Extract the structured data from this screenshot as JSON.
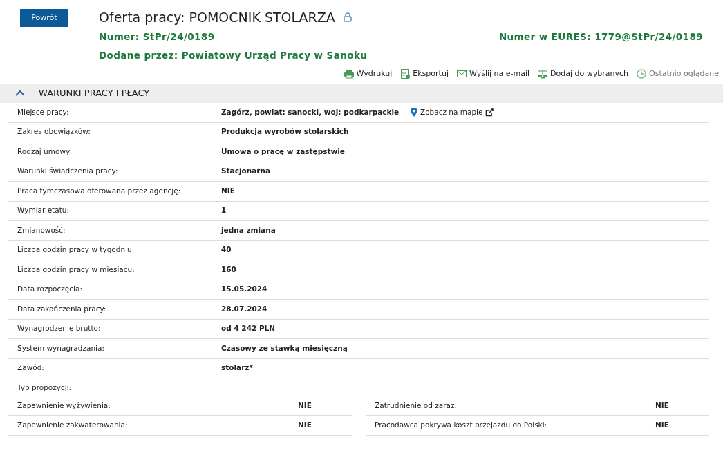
{
  "back_button": "Powrót",
  "title": "Oferta pracy: POMOCNIK STOLARZA",
  "number": "Numer: **StPr/24/0189**",
  "added_by": "Dodane przez: **Powiatowy Urząd Pracy w Sanoku**",
  "eures_number": "Numer w EURES: **1779@StPr/24/0189**",
  "toolbar": [
    {
      "kind": "print",
      "label": "Wydrukuj",
      "disabled": false
    },
    {
      "kind": "export",
      "label": "Eksportuj",
      "disabled": false
    },
    {
      "kind": "email",
      "label": "Wyślij na e-mail",
      "disabled": false
    },
    {
      "kind": "favorite",
      "label": "Dodaj do wybranych",
      "disabled": false
    },
    {
      "kind": "history",
      "label": "Ostatnio oglądane",
      "disabled": true
    }
  ],
  "section": {
    "title": "WARUNKI PRACY I PŁACY",
    "expanded": true
  },
  "rows": [
    {
      "label": "Miejsce pracy:",
      "value": "Zagórz, powiat: sanocki, woj: podkarpackie",
      "map_link": "Zobacz na mapie"
    },
    {
      "label": "Zakres obowiązków:",
      "value": "Produkcja wyrobów stolarskich"
    },
    {
      "label": "Rodzaj umowy:",
      "value": "Umowa o pracę w zastępstwie"
    },
    {
      "label": "Warunki świadczenia pracy:",
      "value": "Stacjonarna"
    },
    {
      "label": "Praca tymczasowa oferowana przez agencję:",
      "value": "NIE"
    },
    {
      "label": "Wymiar etatu:",
      "value": "1"
    },
    {
      "label": "Zmianowość:",
      "value": "jedna zmiana"
    },
    {
      "label": "Liczba godzin pracy w tygodniu:",
      "value": "40"
    },
    {
      "label": "Liczba godzin pracy w miesiącu:",
      "value": "160"
    },
    {
      "label": "Data rozpoczęcia:",
      "value": "15.05.2024"
    },
    {
      "label": "Data zakończenia pracy:",
      "value": "28.07.2024"
    },
    {
      "label": "Wynagrodzenie brutto:",
      "value": "od 4 242 PLN"
    },
    {
      "label": "System wynagradzania:",
      "value": "Czasowy ze stawką miesięczną"
    },
    {
      "label": "Zawód:",
      "value": "stolarz*"
    }
  ],
  "proposal_label": "Typ propozycji:",
  "proposal_items": [
    {
      "label": "Zapewnienie wyżywienia:",
      "value": "NIE"
    },
    {
      "label": "Zatrudnienie od zaraz:",
      "value": "NIE"
    },
    {
      "label": "Zapewnienie zakwaterowania:",
      "value": "NIE"
    },
    {
      "label": "Pracodawca pokrywa koszt przejazdu do Polski:",
      "value": "NIE"
    }
  ]
}
